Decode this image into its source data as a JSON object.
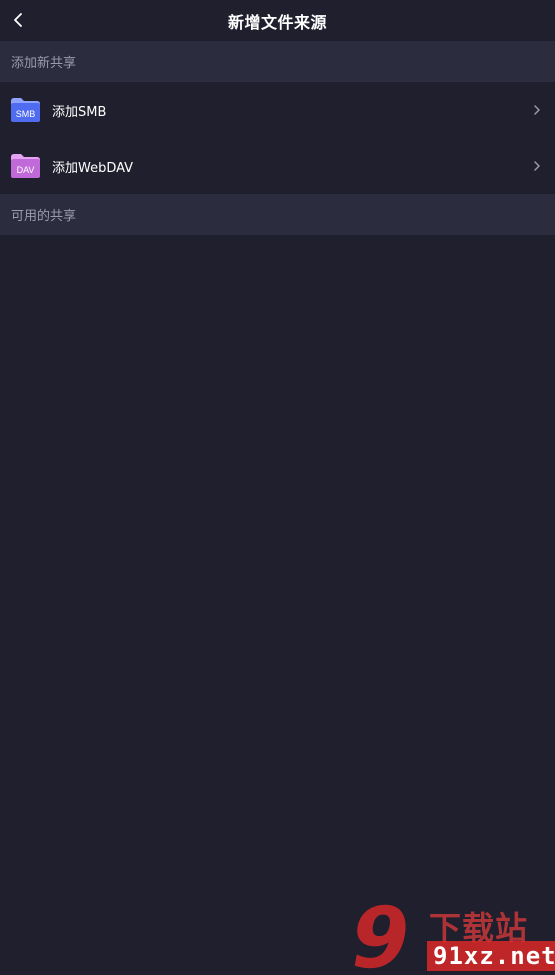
{
  "header": {
    "title": "新增文件来源",
    "back_icon": "chevron-left-icon"
  },
  "sections": {
    "add_new": {
      "label": "添加新共享",
      "items": [
        {
          "label": "添加SMB",
          "icon": "smb-folder-icon",
          "icon_text": "SMB",
          "icon_color": "#4f6bf0"
        },
        {
          "label": "添加WebDAV",
          "icon": "dav-folder-icon",
          "icon_text": "DAV",
          "icon_color": "#c069d8"
        }
      ]
    },
    "available": {
      "label": "可用的共享"
    }
  },
  "watermark": {
    "logo_number": "9",
    "name": "下载站",
    "url": "91xz.net"
  },
  "colors": {
    "background": "#1f1f2d",
    "section_header": "#2b2d3e",
    "section_text": "#9a9cab",
    "smb_accent": "#4f6bf0",
    "dav_accent": "#c069d8"
  }
}
